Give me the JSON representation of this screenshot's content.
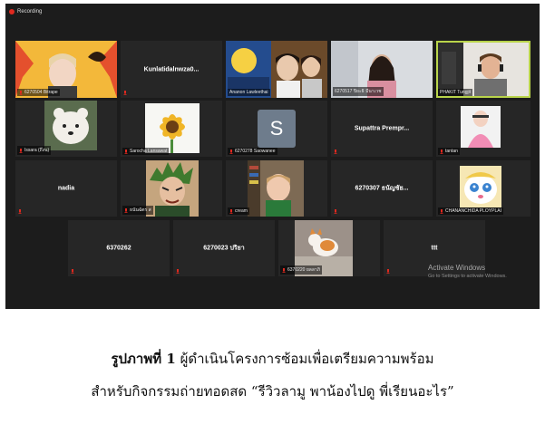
{
  "recording": {
    "label": "Recording",
    "color": "#e0291f"
  },
  "tiles": {
    "r1": [
      {
        "kind": "video",
        "name": "6270504 Bitrape"
      },
      {
        "kind": "name",
        "title": "Kunlatidalnwza0...",
        "muted": true
      },
      {
        "kind": "video",
        "name": "Ananon Lawleethai"
      },
      {
        "kind": "video",
        "name": "6270517 ปิยะธิ มีนาเวช"
      },
      {
        "kind": "video",
        "name": "PHAKIT Tungjit",
        "active": true
      }
    ],
    "r2": [
      {
        "kind": "video",
        "name": "Issara (ถึงน)"
      },
      {
        "kind": "video",
        "name": "Sarocha Lansawat"
      },
      {
        "kind": "avatar",
        "letter": "S",
        "name": "6270278 Saowanee"
      },
      {
        "kind": "name",
        "title": "Supattra Prempr...",
        "muted": true
      },
      {
        "kind": "video",
        "name": "tantan"
      }
    ],
    "r3": [
      {
        "kind": "name",
        "title": "nadia",
        "muted": true
      },
      {
        "kind": "video",
        "name": "ธนันฉัตร ส"
      },
      {
        "kind": "video",
        "name": "cream"
      },
      {
        "kind": "name",
        "title": "6270307 ธนัญชัย...",
        "muted": true
      },
      {
        "kind": "video",
        "name": "CHANANCHIDA PLOYPLAI"
      }
    ],
    "r4": [
      {
        "kind": "name",
        "title": "6370262",
        "muted": true
      },
      {
        "kind": "name",
        "title": "6270023 ปริยา",
        "muted": true
      },
      {
        "kind": "video",
        "name": "6370220 ยลลาภิ"
      },
      {
        "kind": "name",
        "title": "ttt",
        "muted": true
      }
    ]
  },
  "activate": {
    "title": "Activate Windows",
    "subtitle": "Go to Settings to activate Windows."
  },
  "caption": {
    "label": "รูปภาพที่ 1",
    "line1": "ผู้ดำเนินโครงการซ้อมเพื่อเตรียมความพร้อม",
    "line2": "สำหรับกิจกรรมถ่ายทอดสด “รีวิวลามู พาน้องไปดู พี่เรียนอะไร”"
  },
  "colors": {
    "active_border": "#b9d44a",
    "mute": "#e0291f",
    "grid_bg": "#1c1c1c",
    "tile_bg": "#262626"
  }
}
